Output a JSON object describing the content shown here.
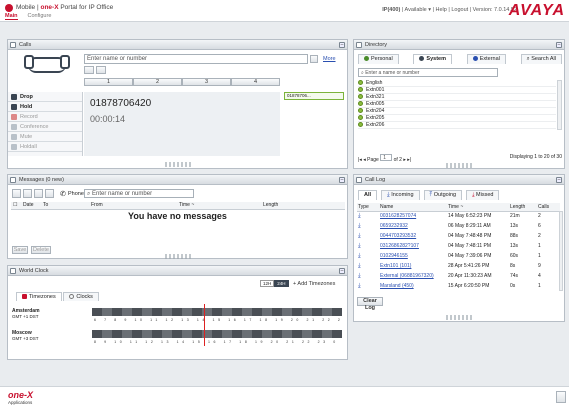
{
  "header": {
    "mobile": "Mobile",
    "brand_prefix": "one-X",
    "title": "Portal for IP Office",
    "nav": [
      "Main",
      "Configure"
    ],
    "ext": "IP(400)",
    "status": "Available",
    "help": "Help",
    "logout": "Logout",
    "version": "Version: 7.0.14.52",
    "logo": "AVAYA",
    "brand_color": "#c8102e"
  },
  "calls": {
    "title": "Calls",
    "input_placeholder": "Enter name or number",
    "more": "More",
    "dialpad": [
      "1",
      "2",
      "3",
      "4"
    ],
    "controls": [
      {
        "label": "Drop",
        "icon": "x-icon",
        "on": true
      },
      {
        "label": "Hold",
        "icon": "hold-icon",
        "on": true
      },
      {
        "label": "Record",
        "icon": "record-icon",
        "on": false
      },
      {
        "label": "Conference",
        "icon": "conference-icon",
        "on": false
      },
      {
        "label": "Mute",
        "icon": "mute-icon",
        "on": false
      },
      {
        "label": "Holdall",
        "icon": "holdall-icon",
        "on": false
      }
    ],
    "number": "01878706420",
    "timer": "00:00:14",
    "call_tag": "01878706..."
  },
  "messages": {
    "title": "Messages (0 new)",
    "phone_label": "Phone",
    "placeholder": "Enter name or number",
    "columns": [
      "Date",
      "To",
      "From",
      "Time ~",
      "Length"
    ],
    "empty": "You have no messages",
    "buttons": [
      "Save",
      "Delete"
    ]
  },
  "world_clock": {
    "title": "World Clock",
    "tabs": [
      "Timezones",
      "Clocks"
    ],
    "toggle": [
      "12H",
      "24H"
    ],
    "add": "+ Add Timezones",
    "zones": [
      {
        "name": "Amsterdam",
        "offset": "GMT +1 DST",
        "ticks": "6 7 8 9 10 11 12 13 14 15 16 17 18 19 20 21 22 23 0 1 2 3 4 5"
      },
      {
        "name": "Moscow",
        "offset": "GMT +3 DST",
        "ticks": "8 9 10 11 12 13 14 15 16 17 18 19 20 21 22 23 0 1 2 3 4 5 6 7"
      }
    ]
  },
  "directory": {
    "title": "Directory",
    "tabs": [
      "Personal",
      "System",
      "External",
      "Search All"
    ],
    "search_placeholder": "Enter a name or number",
    "entries": [
      "English",
      "Extn001",
      "Extn321",
      "Extn005",
      "Extn204",
      "Extn205",
      "Extn206"
    ],
    "page_label": "Page",
    "page": "1",
    "page_of": "of 2",
    "displaying": "Displaying 1 to 20 of 30"
  },
  "call_log": {
    "title": "Call Log",
    "tabs": [
      "All",
      "Incoming",
      "Outgoing",
      "Missed"
    ],
    "columns": [
      "Type",
      "Name",
      "Time ~",
      "Length",
      "Calls"
    ],
    "rows": [
      {
        "name": "0031628257074",
        "time": "14 May 6:52:23 PM",
        "length": "21m",
        "calls": "2"
      },
      {
        "name": "0659232932",
        "time": "06 May 8:29:11 AM",
        "length": "13s",
        "calls": "6"
      },
      {
        "name": "0044703293532",
        "time": "04 May 7:48:48 PM",
        "length": "88s",
        "calls": "2"
      },
      {
        "name": "0312686282?107",
        "time": "04 May 7:48:11 PM",
        "length": "13s",
        "calls": "1"
      },
      {
        "name": "0102946155",
        "time": "04 May 7:39:06 PM",
        "length": "60s",
        "calls": "1"
      },
      {
        "name": "Extn101 (101)",
        "time": "28 Apr 5:41:26 PM",
        "length": "8s",
        "calls": "9"
      },
      {
        "name": "External (06881967320)",
        "time": "20 Apr 11:30:23 AM",
        "length": "74s",
        "calls": "4"
      },
      {
        "name": "Marsland (450)",
        "time": "15 Apr 6:20:50 PM",
        "length": "0s",
        "calls": "1"
      }
    ],
    "clear": "Clear Log"
  },
  "footer": {
    "brand": "one-X",
    "sub": "Applications"
  }
}
